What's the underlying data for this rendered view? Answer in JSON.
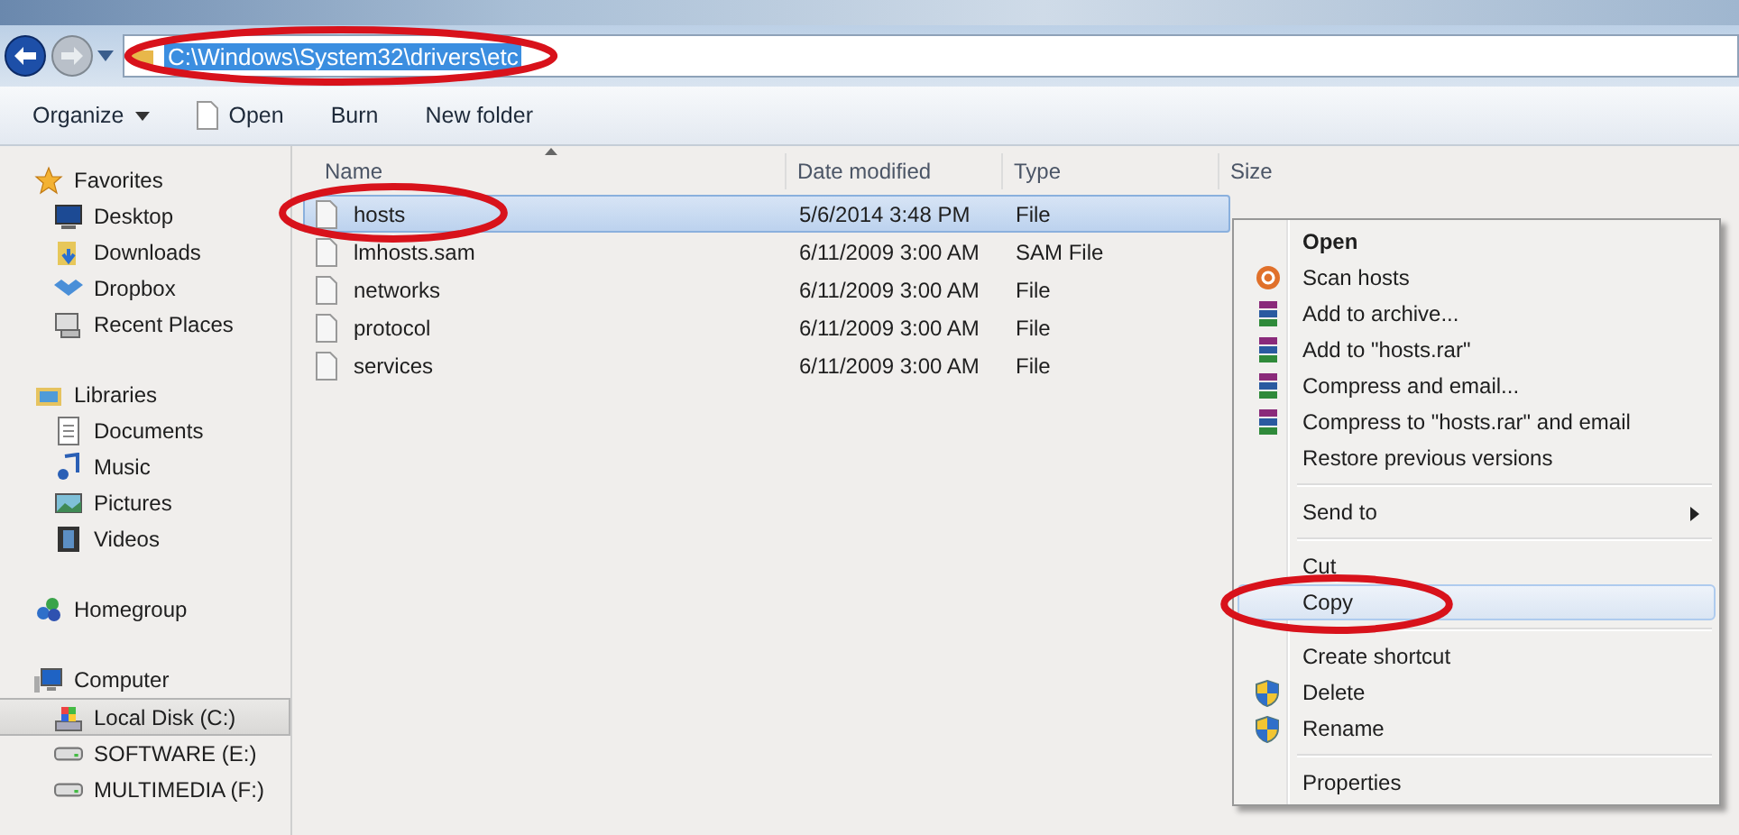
{
  "address": {
    "path": "C:\\Windows\\System32\\drivers\\etc",
    "circled": true
  },
  "toolbar": [
    {
      "label": "Organize",
      "kind": "dropdown"
    },
    {
      "label": "Open",
      "kind": "file"
    },
    {
      "label": "Burn",
      "kind": "plain"
    },
    {
      "label": "New folder",
      "kind": "plain"
    }
  ],
  "sidebar": [
    {
      "label": "Favorites",
      "kind": "star",
      "selected": false,
      "children": [
        {
          "label": "Desktop",
          "kind": "desktop",
          "selected": false
        },
        {
          "label": "Downloads",
          "kind": "download",
          "selected": false
        },
        {
          "label": "Dropbox",
          "kind": "dropbox",
          "selected": false
        },
        {
          "label": "Recent Places",
          "kind": "recent",
          "selected": false
        }
      ]
    },
    {
      "label": "Libraries",
      "kind": "library",
      "selected": false,
      "children": [
        {
          "label": "Documents",
          "kind": "document",
          "selected": false
        },
        {
          "label": "Music",
          "kind": "music",
          "selected": false
        },
        {
          "label": "Pictures",
          "kind": "picture",
          "selected": false
        },
        {
          "label": "Videos",
          "kind": "video",
          "selected": false
        }
      ]
    },
    {
      "label": "Homegroup",
      "kind": "homegroup",
      "selected": false
    },
    {
      "label": "Computer",
      "kind": "computer",
      "selected": false,
      "children": [
        {
          "label": "Local Disk (C:)",
          "kind": "disk",
          "selected": true
        },
        {
          "label": "SOFTWARE (E:)",
          "kind": "drive",
          "selected": false
        },
        {
          "label": "MULTIMEDIA (F:)",
          "kind": "drive",
          "selected": false
        }
      ]
    }
  ],
  "table": {
    "columns": [
      "Name",
      "Date modified",
      "Type",
      "Size"
    ],
    "rows": [
      {
        "name": "hosts",
        "date": "5/6/2014 3:48 PM",
        "type": "File",
        "selected": true,
        "circled": true
      },
      {
        "name": "lmhosts.sam",
        "date": "6/11/2009 3:00 AM",
        "type": "SAM File",
        "selected": false,
        "circled": false
      },
      {
        "name": "networks",
        "date": "6/11/2009 3:00 AM",
        "type": "File",
        "selected": false,
        "circled": false
      },
      {
        "name": "protocol",
        "date": "6/11/2009 3:00 AM",
        "type": "File",
        "selected": false,
        "circled": false
      },
      {
        "name": "services",
        "date": "6/11/2009 3:00 AM",
        "type": "File",
        "selected": false,
        "circled": false
      }
    ]
  },
  "context_menu": [
    {
      "kind": "default",
      "label": "Open",
      "selected": false,
      "circled": false
    },
    {
      "kind": "scan",
      "label": "Scan hosts",
      "selected": false,
      "circled": false
    },
    {
      "kind": "rar",
      "label": "Add to archive...",
      "selected": false,
      "circled": false
    },
    {
      "kind": "rar",
      "label": "Add to \"hosts.rar\"",
      "selected": false,
      "circled": false
    },
    {
      "kind": "rar",
      "label": "Compress and email...",
      "selected": false,
      "circled": false
    },
    {
      "kind": "rar",
      "label": "Compress to \"hosts.rar\" and email",
      "selected": false,
      "circled": false
    },
    {
      "kind": "plain",
      "label": "Restore previous versions",
      "selected": false,
      "circled": false
    },
    {
      "kind": "separator"
    },
    {
      "kind": "submenu",
      "label": "Send to",
      "selected": false,
      "circled": false
    },
    {
      "kind": "separator"
    },
    {
      "kind": "plain",
      "label": "Cut",
      "selected": false,
      "circled": false
    },
    {
      "kind": "plain",
      "label": "Copy",
      "selected": true,
      "circled": true
    },
    {
      "kind": "separator"
    },
    {
      "kind": "plain",
      "label": "Create shortcut",
      "selected": false,
      "circled": false
    },
    {
      "kind": "shield",
      "label": "Delete",
      "selected": false,
      "circled": false
    },
    {
      "kind": "shield",
      "label": "Rename",
      "selected": false,
      "circled": false
    },
    {
      "kind": "separator"
    },
    {
      "kind": "plain",
      "label": "Properties",
      "selected": false,
      "circled": false
    }
  ]
}
